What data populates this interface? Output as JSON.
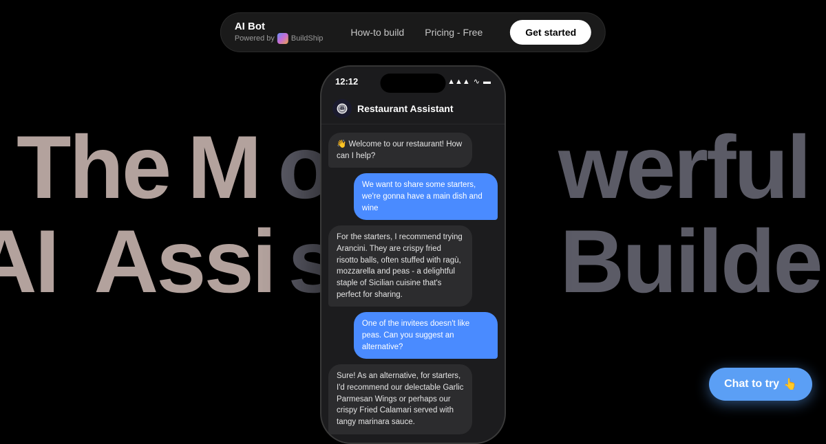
{
  "navbar": {
    "title": "AI Bot",
    "powered_by_label": "Powered by",
    "brand_name": "BuildShip",
    "links": [
      {
        "id": "how-to-build",
        "label": "How-to build"
      },
      {
        "id": "pricing",
        "label": "Pricing - Free"
      }
    ],
    "cta_label": "Get started"
  },
  "background": {
    "line1_part1": "The M",
    "line1_part2": "o",
    "line1_part3": "werful",
    "line2_part1": "AI Assi",
    "line2_part2": "stant",
    "line2_part3": "Builder"
  },
  "phone": {
    "time": "12:12",
    "signal_icon": "▲",
    "wifi_icon": "wifi",
    "battery_icon": "battery",
    "chat_title": "Restaurant Assistant",
    "chat_icon": "🤖",
    "messages": [
      {
        "id": 1,
        "side": "left",
        "text": "👋 Welcome to our restaurant! How can I help?"
      },
      {
        "id": 2,
        "side": "right",
        "text": "We want to share some starters, we're gonna have a main dish and wine"
      },
      {
        "id": 3,
        "side": "left",
        "text": "For the starters, I recommend trying Arancini. They are crispy fried risotto balls, often stuffed with ragù, mozzarella and peas - a delightful staple of Sicilian cuisine that's perfect for sharing."
      },
      {
        "id": 4,
        "side": "right",
        "text": "One of the invitees doesn't like peas. Can you suggest an alternative?"
      },
      {
        "id": 5,
        "side": "left",
        "text": "Sure!\n\nAs an alternative, for starters, I'd recommend our delectable Garlic Parmesan Wings or perhaps our crispy Fried Calamari served with tangy marinara sauce."
      }
    ]
  },
  "chat_try": {
    "label": "Chat to try",
    "emoji": "👆"
  }
}
